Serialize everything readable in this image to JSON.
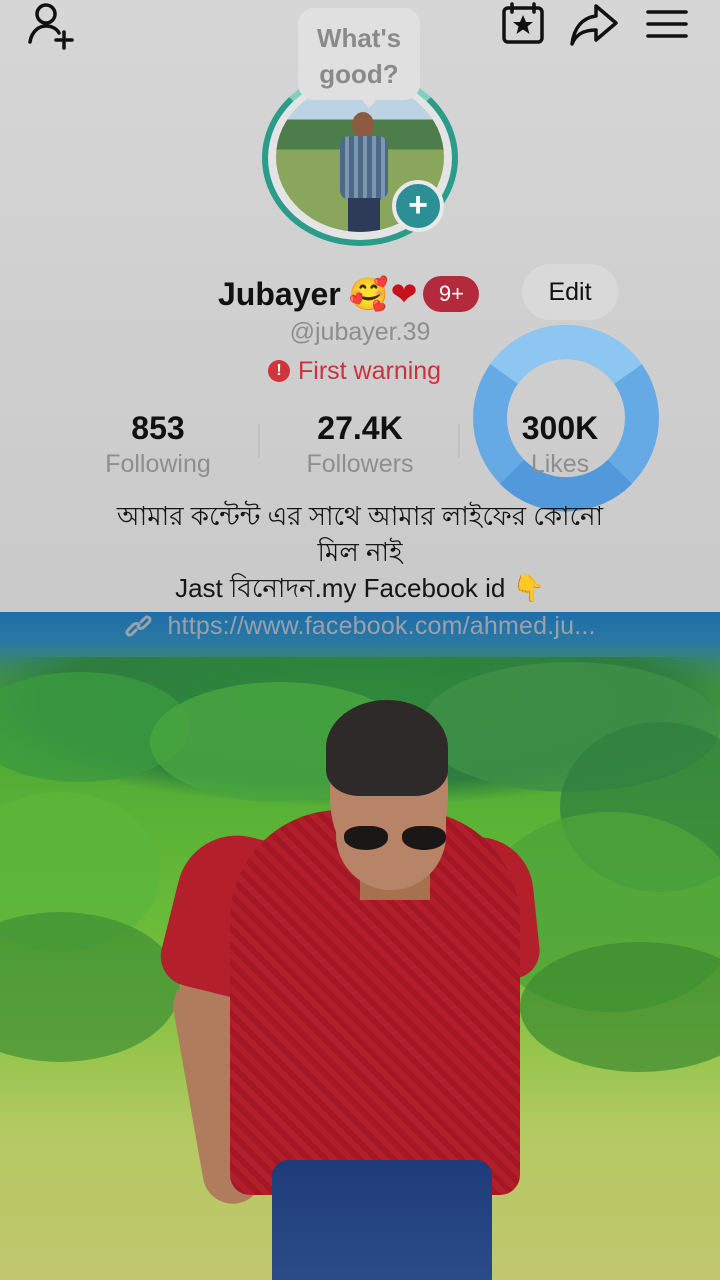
{
  "topbar": {
    "add_friend_icon": "person-plus-icon",
    "calendar_icon": "calendar-star-icon",
    "share_icon": "share-arrow-icon",
    "menu_icon": "hamburger-menu-icon"
  },
  "status_bubble": {
    "line1": "What's",
    "line2": "good?"
  },
  "profile": {
    "name": "Jubayer",
    "emoji_smile": "🥰",
    "emoji_heart": "❤",
    "notification_count": "9+",
    "edit_label": "Edit",
    "handle": "@jubayer.39",
    "warning_icon": "!",
    "warning_text": "First warning"
  },
  "stats": [
    {
      "value": "853",
      "label": "Following"
    },
    {
      "value": "27.4K",
      "label": "Followers"
    },
    {
      "value": "300K",
      "label": "Likes"
    }
  ],
  "bio": {
    "line1": "আমার কন্টেন্ট এর সাথে আমার লাইফের কোনো",
    "line2": "মিল নাই",
    "line3": "Jast বিনোদন.my Facebook id",
    "line3_emoji": "👇",
    "link": "https://www.facebook.com/ahmed.ju..."
  },
  "colors": {
    "ring_teal": "#2b9b8a",
    "badge_red": "#b32a3d",
    "warning_red": "#c9323e",
    "donut_blue": "#5aa6e8",
    "donut_light": "#8ec6f2"
  }
}
